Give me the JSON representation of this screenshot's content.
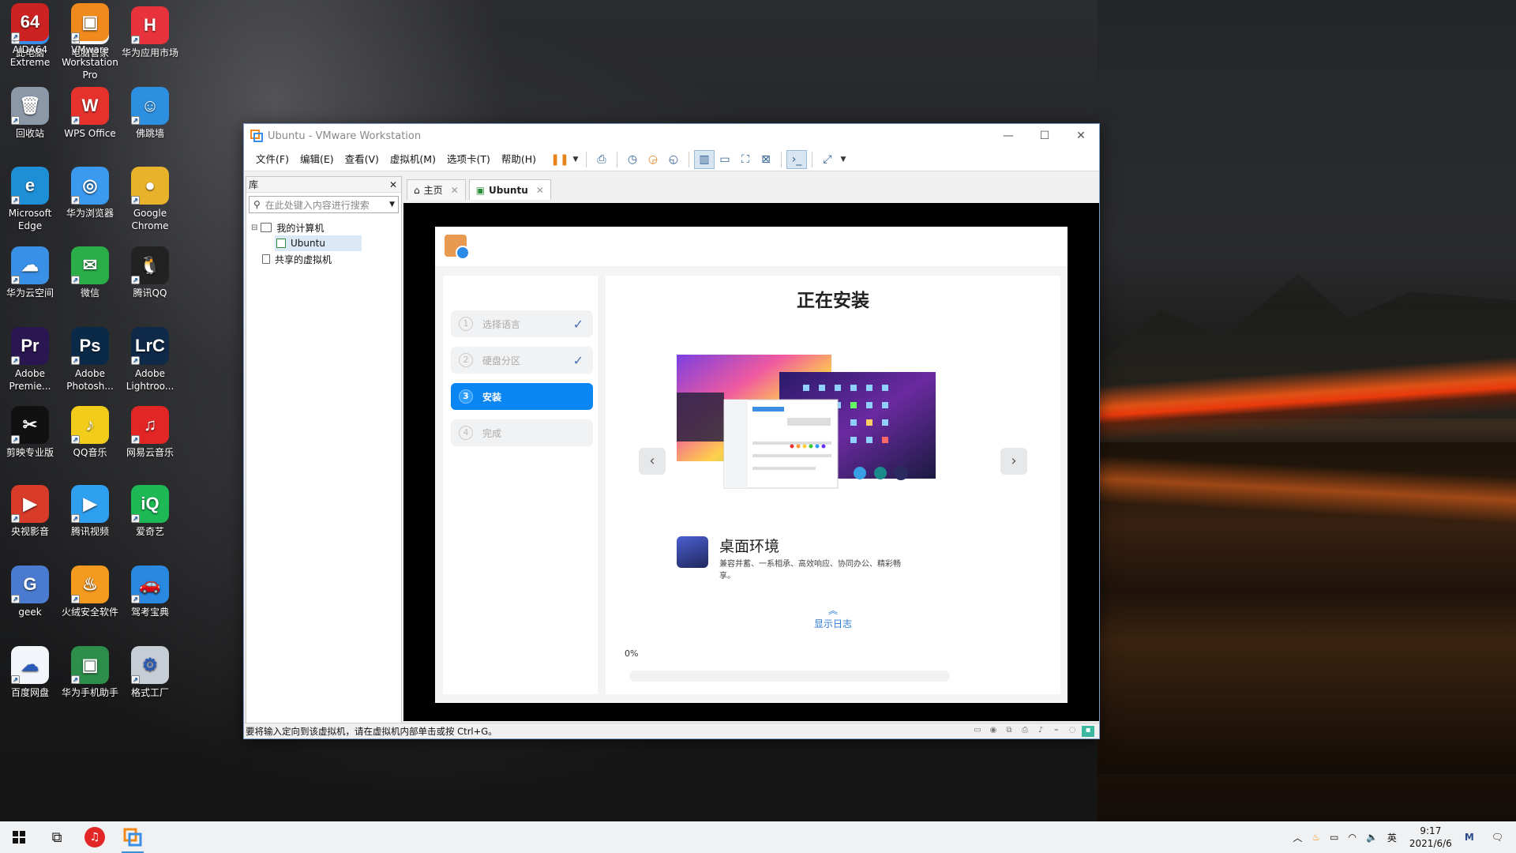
{
  "desktop": {
    "icons": [
      {
        "label": "此电脑",
        "name": "this-pc-icon",
        "color": "#3a8ee6",
        "glyph": "🖥"
      },
      {
        "label": "电脑管家",
        "name": "pc-manager-icon",
        "color": "#f4f6fb",
        "glyph": "M"
      },
      {
        "label": "华为应用市场",
        "name": "huawei-appgallery-icon",
        "color": "#e8333c",
        "glyph": "H"
      },
      {
        "label": "回收站",
        "name": "recycle-bin-icon",
        "color": "#8b98a8",
        "glyph": "🗑"
      },
      {
        "label": "WPS Office",
        "name": "wps-office-icon",
        "color": "#e5322d",
        "glyph": "W"
      },
      {
        "label": "佛跳墙",
        "name": "fotiaoqiang-icon",
        "color": "#2d8fe0",
        "glyph": "☺"
      },
      {
        "label": "Microsoft Edge",
        "name": "edge-icon",
        "color": "#1e8fd6",
        "glyph": "e"
      },
      {
        "label": "华为浏览器",
        "name": "huawei-browser-icon",
        "color": "#3a9af0",
        "glyph": "◎"
      },
      {
        "label": "Google Chrome",
        "name": "chrome-icon",
        "color": "#e8b22a",
        "glyph": "●"
      },
      {
        "label": "华为云空间",
        "name": "huawei-cloud-icon",
        "color": "#3a8fe6",
        "glyph": "☁"
      },
      {
        "label": "微信",
        "name": "wechat-icon",
        "color": "#2aae48",
        "glyph": "✉"
      },
      {
        "label": "腾讯QQ",
        "name": "qq-icon",
        "color": "#222",
        "glyph": "🐧"
      },
      {
        "label": "Adobe Premie...",
        "name": "premiere-icon",
        "color": "#2a1650",
        "glyph": "Pr"
      },
      {
        "label": "Adobe Photosh...",
        "name": "photoshop-icon",
        "color": "#0b2a48",
        "glyph": "Ps"
      },
      {
        "label": "Adobe Lightroo...",
        "name": "lightroom-icon",
        "color": "#0f2a48",
        "glyph": "LrC"
      },
      {
        "label": "剪映专业版",
        "name": "jianying-icon",
        "color": "#111",
        "glyph": "✂"
      },
      {
        "label": "QQ音乐",
        "name": "qq-music-icon",
        "color": "#f2cc1a",
        "glyph": "♪"
      },
      {
        "label": "网易云音乐",
        "name": "netease-music-icon",
        "color": "#e22626",
        "glyph": "♫"
      },
      {
        "label": "央视影音",
        "name": "cctv-icon",
        "color": "#d83b2a",
        "glyph": "▶"
      },
      {
        "label": "腾讯视频",
        "name": "tencent-video-icon",
        "color": "#2f9ff0",
        "glyph": "▶"
      },
      {
        "label": "爱奇艺",
        "name": "iqiyi-icon",
        "color": "#1db954",
        "glyph": "iQ"
      },
      {
        "label": "geek",
        "name": "geek-icon",
        "color": "#4a7bd0",
        "glyph": "G"
      },
      {
        "label": "火绒安全软件",
        "name": "huorong-icon",
        "color": "#f39a1f",
        "glyph": "♨"
      },
      {
        "label": "驾考宝典",
        "name": "jiakao-icon",
        "color": "#2a88e0",
        "glyph": "🚗"
      },
      {
        "label": "百度网盘",
        "name": "baidu-netdisk-icon",
        "color": "#f2f6fb",
        "glyph": "☁"
      },
      {
        "label": "华为手机助手",
        "name": "huawei-phone-assistant-icon",
        "color": "#2c8e4a",
        "glyph": "▣"
      },
      {
        "label": "格式工厂",
        "name": "format-factory-icon",
        "color": "#c8ced6",
        "glyph": "⚙"
      },
      {
        "label": "AIDA64 Extreme",
        "name": "aida64-icon",
        "color": "#c22",
        "glyph": "64"
      },
      {
        "label": "VMware Workstation Pro",
        "name": "vmware-icon",
        "color": "#f08a1c",
        "glyph": "▣"
      }
    ]
  },
  "window": {
    "title": "Ubuntu - VMware Workstation",
    "menus": [
      "文件(F)",
      "编辑(E)",
      "查看(V)",
      "虚拟机(M)",
      "选项卡(T)",
      "帮助(H)"
    ],
    "library": {
      "header": "库",
      "search_placeholder": "在此处键入内容进行搜索",
      "tree": {
        "my_computer": "我的计算机",
        "ubuntu": "Ubuntu",
        "shared": "共享的虚拟机"
      }
    },
    "tabs": {
      "home": "主页",
      "ubuntu": "Ubuntu"
    },
    "status_text": "要将输入定向到该虚拟机，请在虚拟机内部单击或按 Ctrl+G。"
  },
  "installer": {
    "title": "正在安装",
    "steps": [
      {
        "num": "1",
        "label": "选择语言",
        "done": true
      },
      {
        "num": "2",
        "label": "硬盘分区",
        "done": true
      },
      {
        "num": "3",
        "label": "安装",
        "current": true
      },
      {
        "num": "4",
        "label": "完成"
      }
    ],
    "feature_title": "桌面环境",
    "feature_desc": "兼容并蓄、一系相承、高效响应、协同办公、精彩畅享。",
    "show_log": "显示日志",
    "progress_text": "0%",
    "progress": 0
  },
  "taskbar": {
    "ime": "英",
    "time": "9:17",
    "date": "2021/6/6"
  }
}
